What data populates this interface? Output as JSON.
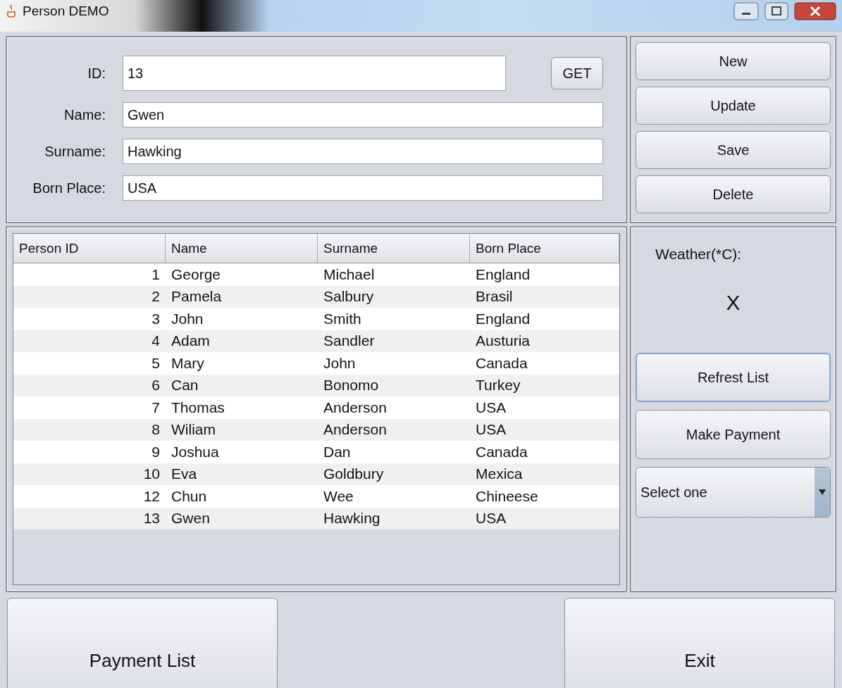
{
  "window": {
    "title": "Person DEMO"
  },
  "form": {
    "fields": [
      {
        "label": "ID:",
        "value": "13"
      },
      {
        "label": "Name:",
        "value": "Gwen"
      },
      {
        "label": "Surname:",
        "value": "Hawking"
      },
      {
        "label": "Born Place:",
        "value": "USA"
      }
    ],
    "get_button": "GET"
  },
  "action_buttons": [
    {
      "label": "New",
      "focused": false
    },
    {
      "label": "Update",
      "focused": false
    },
    {
      "label": "Save",
      "focused": false
    },
    {
      "label": "Delete",
      "focused": false
    }
  ],
  "table": {
    "columns": [
      "Person ID",
      "Name",
      "Surname",
      "Born Place"
    ],
    "rows": [
      [
        "1",
        "George",
        "Michael",
        "England"
      ],
      [
        "2",
        "Pamela",
        "Salbury",
        "Brasil"
      ],
      [
        "3",
        "John",
        "Smith",
        "England"
      ],
      [
        "4",
        "Adam",
        "Sandler",
        "Austuria"
      ],
      [
        "5",
        "Mary",
        "John",
        "Canada"
      ],
      [
        "6",
        "Can",
        "Bonomo",
        "Turkey"
      ],
      [
        "7",
        "Thomas",
        "Anderson",
        "USA"
      ],
      [
        "8",
        "Wiliam",
        "Anderson",
        "USA"
      ],
      [
        "9",
        "Joshua",
        "Dan",
        "Canada"
      ],
      [
        "10",
        "Eva",
        "Goldbury",
        "Mexica"
      ],
      [
        "12",
        "Chun",
        "Wee",
        "Chineese"
      ],
      [
        "13",
        "Gwen",
        "Hawking",
        "USA"
      ]
    ]
  },
  "side": {
    "weather_label": "Weather(*C):",
    "weather_value": "X",
    "buttons": [
      {
        "label": "Refrest List",
        "focused": true
      },
      {
        "label": "Make Payment",
        "focused": false
      }
    ],
    "select": {
      "value": "Select one"
    }
  },
  "bottom_buttons": [
    "Payment List",
    "Exit"
  ]
}
